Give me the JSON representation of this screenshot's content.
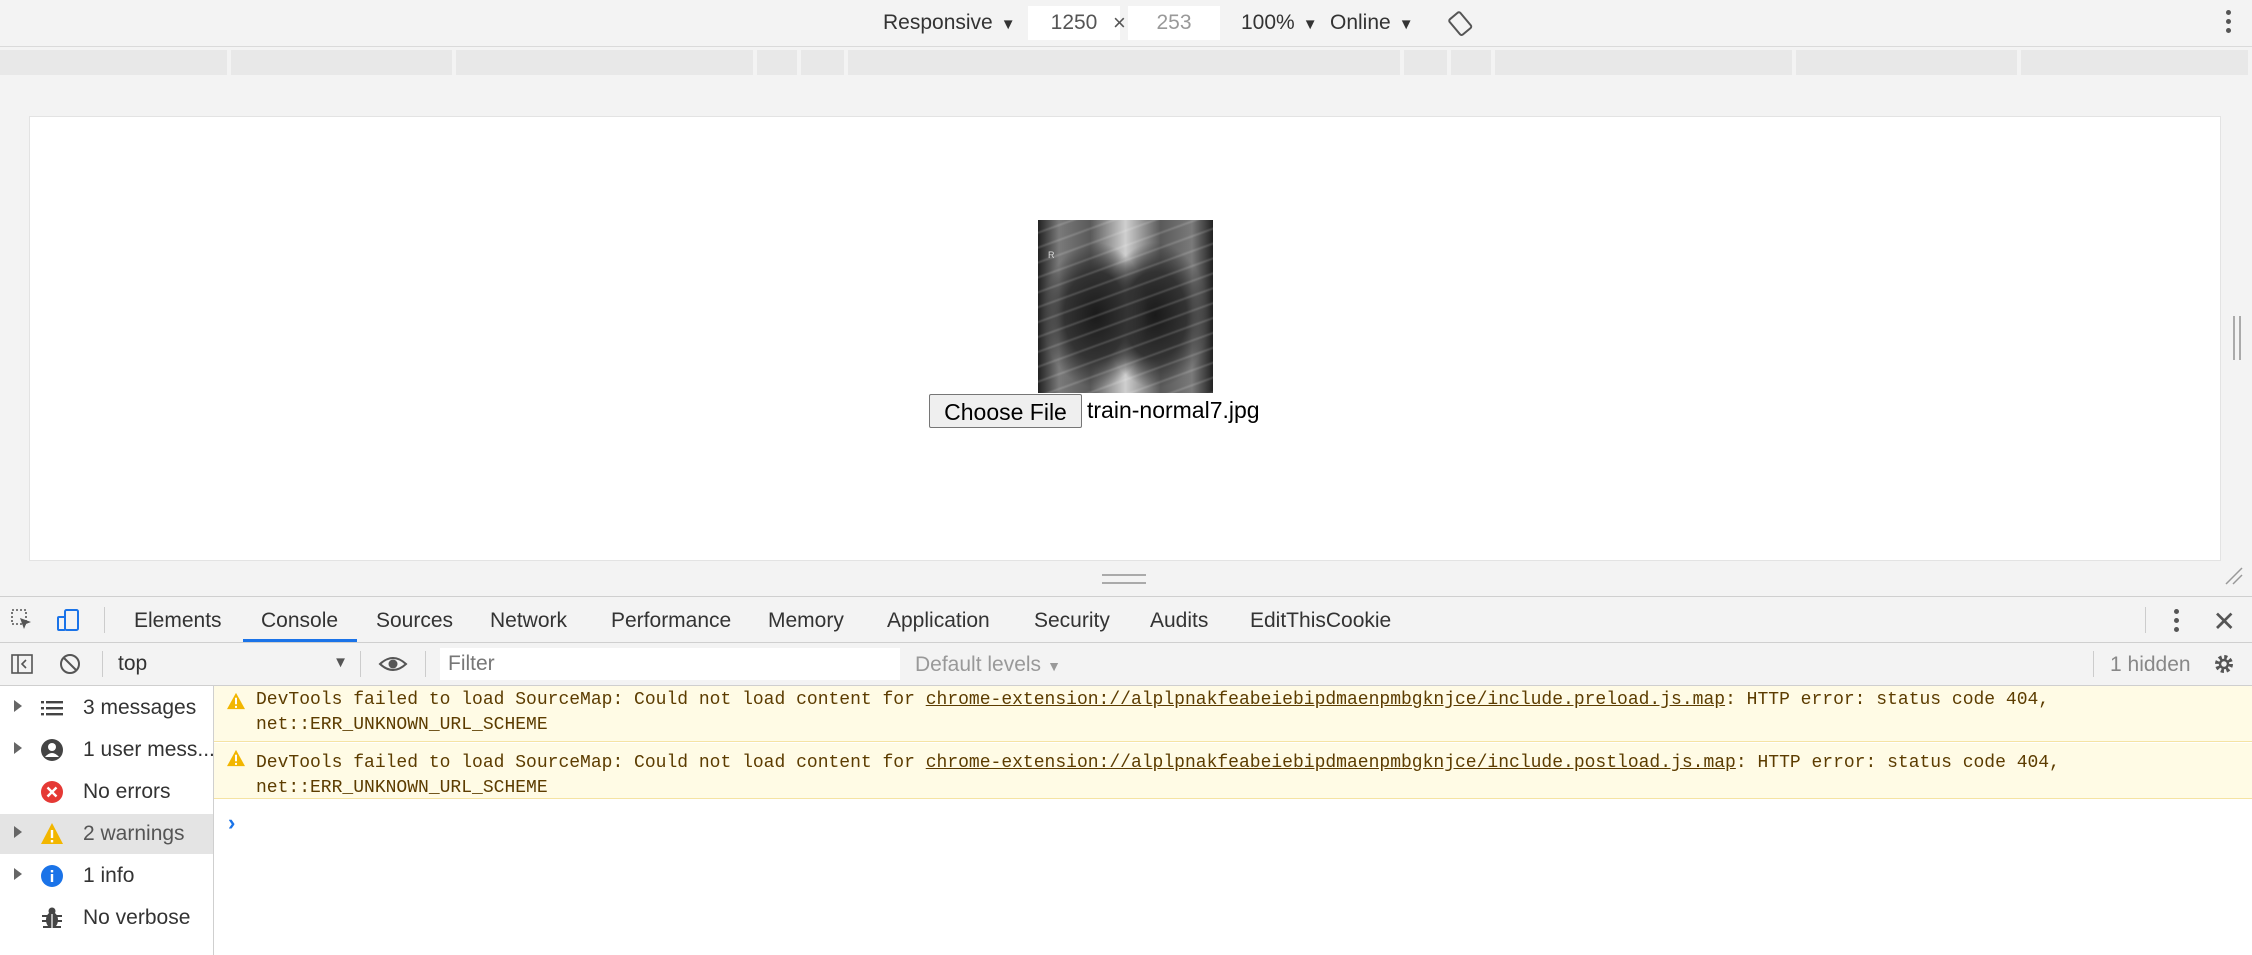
{
  "device_toolbar": {
    "device": "Responsive",
    "width": "1250",
    "times": "×",
    "height": "253",
    "zoom": "100%",
    "network": "Online"
  },
  "page": {
    "choose_file_label": "Choose File",
    "file_name": "train-normal7.jpg",
    "xray_marker": "R"
  },
  "devtools": {
    "tabs": [
      "Elements",
      "Console",
      "Sources",
      "Network",
      "Performance",
      "Memory",
      "Application",
      "Security",
      "Audits",
      "EditThisCookie"
    ],
    "active_tab": "Console",
    "console": {
      "context": "top",
      "filter_placeholder": "Filter",
      "levels": "Default levels",
      "hidden": "1 hidden"
    },
    "sidebar": [
      {
        "label": "3 messages",
        "icon": "list-icon",
        "expandable": true,
        "selected": false
      },
      {
        "label": "1 user mess...",
        "icon": "user-icon",
        "expandable": true,
        "selected": false
      },
      {
        "label": "No errors",
        "icon": "error-icon",
        "expandable": false,
        "selected": false
      },
      {
        "label": "2 warnings",
        "icon": "warning-icon",
        "expandable": true,
        "selected": true
      },
      {
        "label": "1 info",
        "icon": "info-icon",
        "expandable": true,
        "selected": false
      },
      {
        "label": "No verbose",
        "icon": "bug-icon",
        "expandable": false,
        "selected": false
      }
    ],
    "messages": [
      {
        "prefix": "DevTools failed to load SourceMap: Could not load content for ",
        "link": "chrome-extension://alplpnakfeabeiebipdmaenpmbgknjce/include.preload.js.map",
        "suffix": ": HTTP error: status code 404,",
        "line2": "net::ERR_UNKNOWN_URL_SCHEME"
      },
      {
        "prefix": "DevTools failed to load SourceMap: Could not load content for ",
        "link": "chrome-extension://alplpnakfeabeiebipdmaenpmbgknjce/include.postload.js.map",
        "suffix": ": HTTP error: status code 404,",
        "line2": "net::ERR_UNKNOWN_URL_SCHEME"
      }
    ],
    "prompt": "›"
  },
  "colors": {
    "accent": "#1a73e8",
    "warning_bg": "#fffbe5",
    "warning_text": "#5c3c00",
    "error": "#e53935",
    "warning_icon": "#f2b600",
    "info": "#1a73e8"
  }
}
